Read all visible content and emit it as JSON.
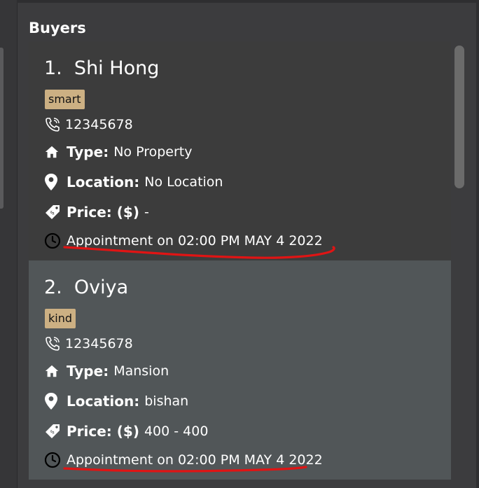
{
  "panel": {
    "title": "Buyers"
  },
  "buyers": [
    {
      "index_name": "1.  Shi Hong",
      "tag": "smart",
      "phone": "12345678",
      "type_label": "Type:",
      "type_value": "No Property",
      "location_label": "Location:",
      "location_value": "No Location",
      "price_label": "Price: ($)",
      "price_value": "-",
      "appointment": "Appointment on 02:00 PM MAY 4 2022"
    },
    {
      "index_name": "2.  Oviya",
      "tag": "kind",
      "phone": "12345678",
      "type_label": "Type:",
      "type_value": "Mansion",
      "location_label": "Location:",
      "location_value": "bishan",
      "price_label": "Price: ($)",
      "price_value": "400 - 400",
      "appointment": "Appointment on 02:00 PM MAY 4 2022"
    }
  ],
  "icons": [
    "phone-icon",
    "home-icon",
    "location-pin-icon",
    "price-tag-icon",
    "clock-icon"
  ],
  "colors": {
    "background": "#3c3c3e",
    "card_default": "#3c3c3c",
    "card_selected": "#515658",
    "tag": "#ccb083",
    "annotation": "#e01414"
  }
}
